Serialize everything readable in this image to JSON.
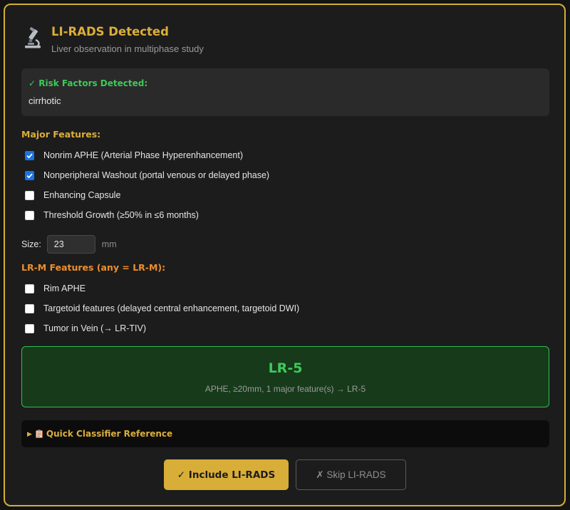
{
  "header": {
    "title": "LI-RADS Detected",
    "subtitle": "Liver observation in multiphase study",
    "icon": "microscope-icon"
  },
  "risk": {
    "title": "✓ Risk Factors Detected:",
    "value": "cirrhotic"
  },
  "major": {
    "title": "Major Features:",
    "items": [
      {
        "label": "Nonrim APHE (Arterial Phase Hyperenhancement)",
        "checked": true
      },
      {
        "label": "Nonperipheral Washout (portal venous or delayed phase)",
        "checked": true
      },
      {
        "label": "Enhancing Capsule",
        "checked": false
      },
      {
        "label": "Threshold Growth (≥50% in ≤6 months)",
        "checked": false
      }
    ]
  },
  "size": {
    "label": "Size:",
    "value": "23",
    "unit": "mm"
  },
  "lrm": {
    "title": "LR-M Features (any = LR-M):",
    "items": [
      {
        "label": "Rim APHE",
        "checked": false
      },
      {
        "label": "Targetoid features (delayed central enhancement, targetoid DWI)",
        "checked": false
      },
      {
        "label": "Tumor in Vein (→ LR-TIV)",
        "checked": false
      }
    ]
  },
  "result": {
    "category": "LR-5",
    "reason": "APHE, ≥20mm, 1 major feature(s) → LR-5"
  },
  "reference": {
    "caret": "▶",
    "label": "Quick Classifier Reference"
  },
  "buttons": {
    "include": "✓ Include LI-RADS",
    "skip": "✗ Skip LI-RADS"
  },
  "colors": {
    "accent": "#d4af37",
    "success": "#3ec95a",
    "warning": "#ee8f2c",
    "checkbox": "#1a73e8"
  }
}
